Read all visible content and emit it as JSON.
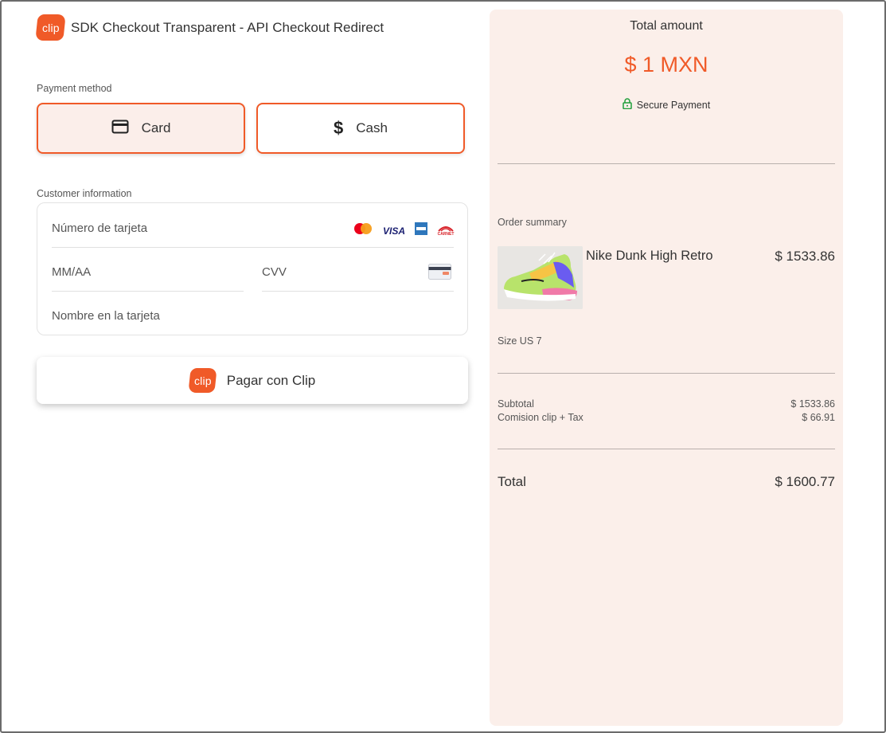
{
  "header": {
    "logo_text": "clip",
    "title": "SDK Checkout Transparent - API Checkout Redirect"
  },
  "payment": {
    "section_label": "Payment method",
    "methods": [
      {
        "label": "Card",
        "icon": "credit-card-icon",
        "selected": true
      },
      {
        "label": "Cash",
        "icon": "dollar-icon",
        "selected": false
      }
    ]
  },
  "customer": {
    "section_label": "Customer information",
    "card_number_placeholder": "Número de tarjeta",
    "expiry_placeholder": "MM/AA",
    "cvv_placeholder": "CVV",
    "name_placeholder": "Nombre en la tarjeta",
    "brands": [
      "mastercard-icon",
      "VISA",
      "amex-icon",
      "CARNET"
    ]
  },
  "pay_button": {
    "label": "Pagar con Clip",
    "logo_text": "clip"
  },
  "summary": {
    "total_label": "Total amount",
    "total_amount": "$ 1 MXN",
    "secure_label": "Secure Payment",
    "order_label": "Order summary",
    "product": {
      "name": "Nike Dunk High Retro",
      "price": "$ 1533.86",
      "size": "Size US 7"
    },
    "subtotal_label": "Subtotal",
    "subtotal_value": "$ 1533.86",
    "fee_label": "Comision clip + Tax",
    "fee_value": "$ 66.91",
    "grand_total_label": "Total",
    "grand_total_value": "$ 1600.77"
  },
  "colors": {
    "brand": "#f05a28",
    "summary_bg": "#fbefea",
    "secure_green": "#1e9e3a"
  }
}
